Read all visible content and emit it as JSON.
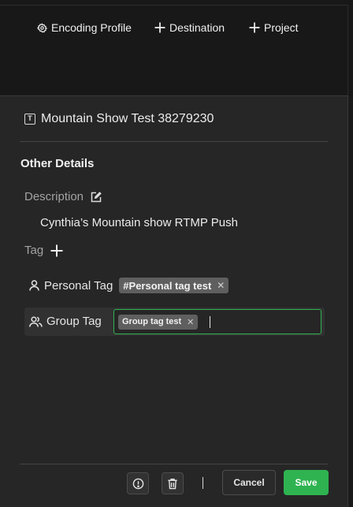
{
  "toolbar": {
    "encoding_profile_label": "Encoding Profile",
    "destination_label": "Destination",
    "project_label": "Project"
  },
  "form": {
    "title": "Mountain Show Test 38279230",
    "section_title": "Other Details",
    "description_label": "Description",
    "description_value": "Cynthia’s Mountain show RTMP Push",
    "tag_label": "Tag",
    "personal_tag": {
      "label": "Personal Tag",
      "chips": [
        "#Personal tag test"
      ]
    },
    "group_tag": {
      "label": "Group Tag",
      "chips": [
        "Group tag test"
      ],
      "input_value": ""
    }
  },
  "footer": {
    "cancel_label": "Cancel",
    "save_label": "Save"
  },
  "icons": {
    "settings": "gear-icon",
    "add": "plus-icon",
    "title": "text-box-icon",
    "edit": "edit-icon",
    "user": "user-icon",
    "group": "users-icon",
    "remove": "close-icon",
    "info": "info-icon",
    "delete": "trash-icon"
  },
  "colors": {
    "accent": "#2fb351",
    "background": "#262626",
    "toolbar_background": "#181818",
    "chip_background": "#5f5f5f"
  }
}
